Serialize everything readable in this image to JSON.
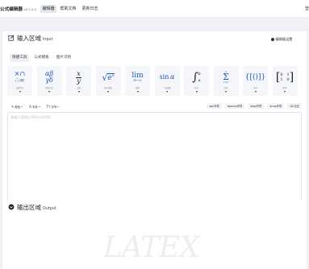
{
  "app": {
    "title": "公式编辑器",
    "version": "v0.1.0.2"
  },
  "nav": [
    {
      "label": "编辑器",
      "active": true
    },
    {
      "label": "帮助文档",
      "active": false
    },
    {
      "label": "更新日志",
      "active": false
    }
  ],
  "top_right": "登",
  "input_panel": {
    "title": "输入区域",
    "title_en": "Input",
    "settings_label": "编辑器设置",
    "tabs": [
      {
        "label": "快捷工具",
        "active": true
      },
      {
        "label": "公式模板",
        "active": false
      },
      {
        "label": "图片识别",
        "active": false
      }
    ],
    "tools": [
      {
        "symbol": "×∩\n∴∞",
        "caption": "运算符号"
      },
      {
        "symbol": "αβ\nγδ",
        "caption": "希腊字母"
      },
      {
        "symbol": "x/y",
        "caption": "分数"
      },
      {
        "symbol": "√eˣ",
        "caption": "根号指数"
      },
      {
        "symbol": "lim\nn→∞",
        "caption": "极限"
      },
      {
        "symbol": "sin α",
        "caption": "三角函数"
      },
      {
        "symbol": "∫ₐᵇ",
        "caption": "积分"
      },
      {
        "symbol": "Σ",
        "caption": "求和"
      },
      {
        "symbol": "{()}",
        "caption": "括号"
      },
      {
        "symbol": "[0 1; 1 0]",
        "caption": "矩阵"
      }
    ],
    "options": [
      "颜色",
      "字体",
      "字号"
    ],
    "envs": [
      "aqu环境",
      "lspacey环境",
      "align环境",
      "array环境",
      "清空"
    ],
    "editor_placeholder": "请输入您的LaTeX公式代码"
  },
  "output_panel": {
    "title": "输出区域",
    "title_en": "Output",
    "watermark": "LATEX"
  }
}
